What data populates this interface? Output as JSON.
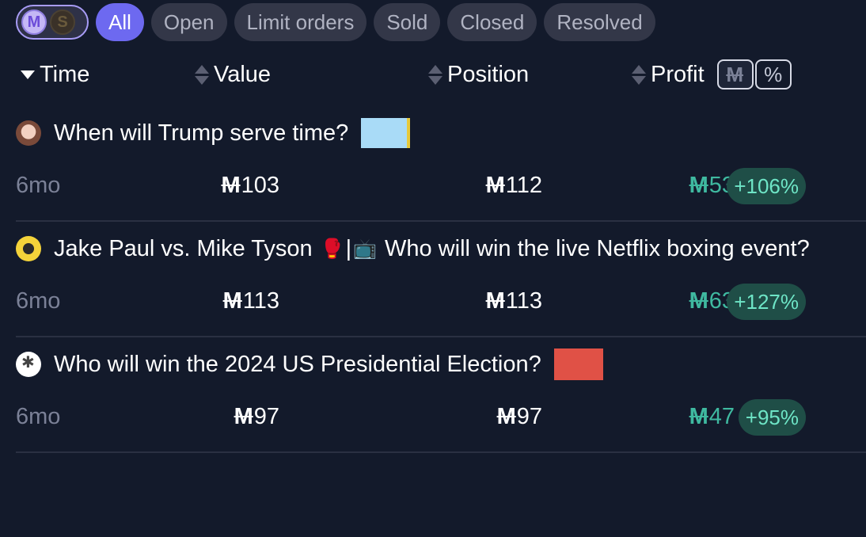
{
  "filters": {
    "currency_icons": [
      "mana-coin-icon",
      "sweepcash-coin-icon"
    ],
    "currency_glyphs": {
      "mana": "M",
      "sweeps": "S"
    },
    "pills": [
      {
        "label": "All",
        "active": true
      },
      {
        "label": "Open",
        "active": false
      },
      {
        "label": "Limit orders",
        "active": false
      },
      {
        "label": "Sold",
        "active": false
      },
      {
        "label": "Closed",
        "active": false
      },
      {
        "label": "Resolved",
        "active": false
      }
    ]
  },
  "columns": {
    "time": "Time",
    "value": "Value",
    "position": "Position",
    "profit": "Profit",
    "profit_mode_mana": "M",
    "profit_mode_percent": "%"
  },
  "currency_symbol": "M",
  "rows": [
    {
      "avatar": "user-avatar-icon",
      "title": "When will Trump serve time?",
      "time": "6mo",
      "value": "103",
      "position": "112",
      "profit": "53",
      "profit_pct": "+106%"
    },
    {
      "avatar": "user-avatar-icon",
      "title_part1": "Jake Paul vs. Mike Tyson",
      "title_emoji1": "🥊",
      "title_sep": "|",
      "title_emoji2": "📺",
      "title_part2": "Who will win the live Netflix boxing event?",
      "time": "6mo",
      "value": "113",
      "position": "113",
      "profit": "63",
      "profit_pct": "+127%"
    },
    {
      "avatar": "user-avatar-icon",
      "title": "Who will win the 2024 US Presidential Election?",
      "time": "6mo",
      "value": "97",
      "position": "97",
      "profit": "47",
      "profit_pct": "+95%"
    }
  ],
  "colors": {
    "background": "#131a2b",
    "accent": "#6d69f0",
    "profit_green": "#3fb9a0",
    "badge_bg": "#1f4e47",
    "prob_light_blue": "#a9dbf7",
    "prob_red": "#e05146"
  }
}
